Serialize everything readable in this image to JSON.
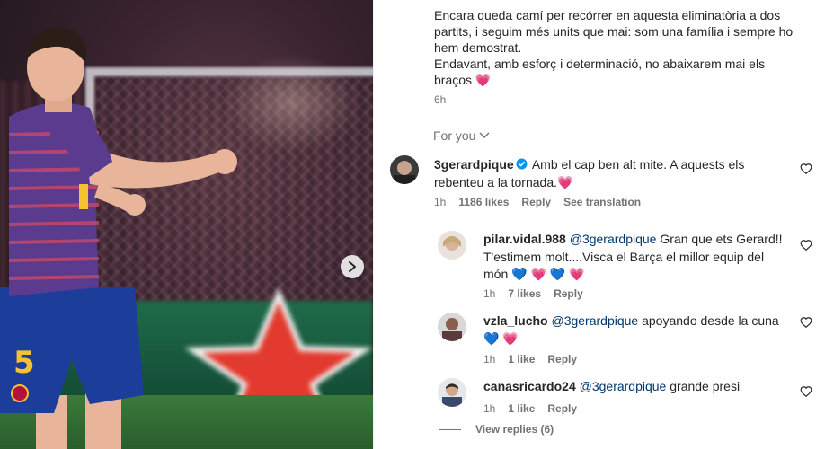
{
  "photo": {
    "alt": "",
    "nav": "next-arrow"
  },
  "caption": {
    "lines": [
      "Encara queda camí per recórrer en aquesta eliminatòria a dos partits, i seguim més units que mai: som una família i sempre ho hem demostrat.",
      "Endavant, amb esforç i determinació, no abaixarem mai els braços"
    ],
    "emoji": "💗",
    "time": "6h"
  },
  "for_you": "For you",
  "comments": [
    {
      "user": "3gerardpique",
      "verified": true,
      "text": "Amb el cap ben alt mite. A aquests els rebenteu a la tornada.",
      "emoji": "💗",
      "time": "1h",
      "likes": "1186 likes",
      "reply": "Reply",
      "translate": "See translation"
    },
    {
      "user": "pilar.vidal.988",
      "mention": "@3gerardpique",
      "text": "Gran que ets Gerard!! T'estimem molt....Visca el Barça el millor equip del món",
      "emojis": [
        "💙",
        "💗",
        "💙",
        "💗"
      ],
      "time": "1h",
      "likes": "7 likes",
      "reply": "Reply"
    },
    {
      "user": "vzla_lucho",
      "mention": "@3gerardpique",
      "text": "apoyando desde la cuna",
      "emojis": [
        "💙",
        "💗"
      ],
      "time": "1h",
      "likes": "1 like",
      "reply": "Reply"
    },
    {
      "user": "canasricardo24",
      "mention": "@3gerardpique",
      "text": "grande presi",
      "time": "1h",
      "likes": "1 like",
      "reply": "Reply"
    }
  ],
  "view_replies": "View replies (6)",
  "colors": {
    "text": "#262626",
    "muted": "#737373",
    "mention": "#00376b",
    "verified": "#0095f6"
  }
}
